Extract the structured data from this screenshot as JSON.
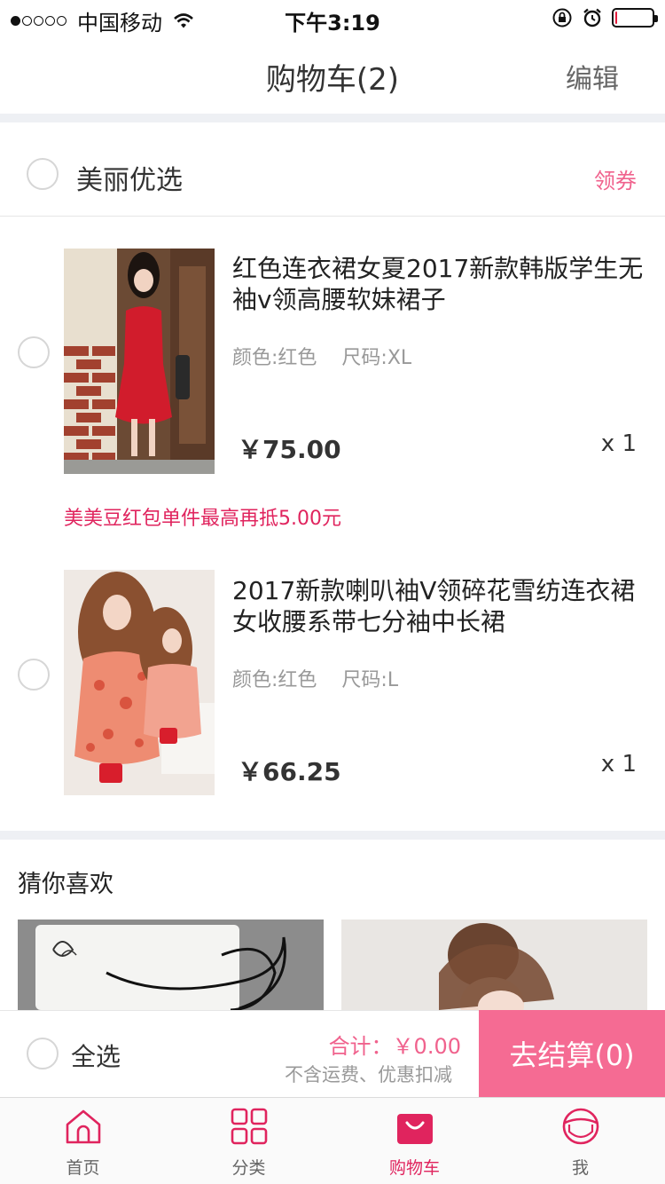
{
  "status_bar": {
    "carrier": "中国移动",
    "time": "下午3:19",
    "battery_level_fraction": 0.06
  },
  "nav": {
    "title": "购物车(2)",
    "edit_label": "编辑"
  },
  "store": {
    "name": "美丽优选",
    "coupon_label": "领券"
  },
  "products": [
    {
      "title": "红色连衣裙女夏2017新款韩版学生无袖v领高腰软妹裙子",
      "color": "颜色:红色",
      "size": "尺码:XL",
      "price": "￥75.00",
      "qty": "x 1"
    },
    {
      "title": "2017新款喇叭袖V领碎花雪纺连衣裙女收腰系带七分袖中长裙",
      "color": "颜色:红色",
      "size": "尺码:L",
      "price": "￥66.25",
      "qty": "x 1"
    }
  ],
  "promo": "美美豆红包单件最高再抵5.00元",
  "recommend": {
    "title": "猜你喜欢"
  },
  "action_bar": {
    "select_all_label": "全选",
    "total": "合计：￥0.00",
    "note": "不含运费、优惠扣减",
    "checkout_label": "去结算(0)"
  },
  "tabbar": {
    "tabs": [
      {
        "label": "首页",
        "icon": "home-icon"
      },
      {
        "label": "分类",
        "icon": "category-icon"
      },
      {
        "label": "购物车",
        "icon": "cart-bag-icon"
      },
      {
        "label": "我",
        "icon": "profile-icon"
      }
    ],
    "active_index": 2
  },
  "colors": {
    "accent": "#f56b93",
    "accent_dark": "#e0245e",
    "coupon": "#f0628d"
  }
}
